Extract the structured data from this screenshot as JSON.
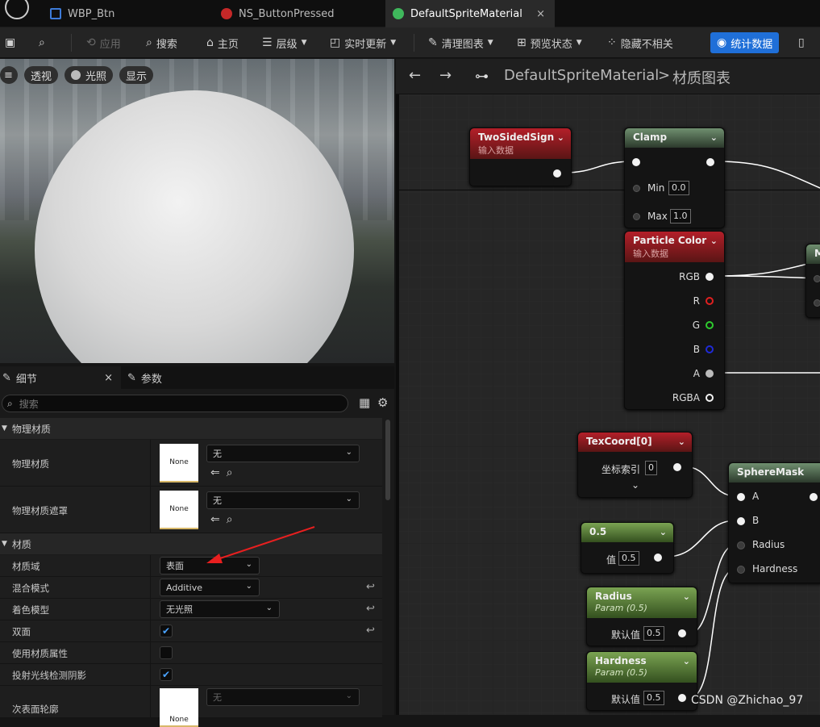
{
  "tabs": [
    {
      "label": "WBP_Btn",
      "icon": "widget-blueprint-icon"
    },
    {
      "label": "NS_ButtonPressed",
      "icon": "niagara-system-icon"
    },
    {
      "label": "DefaultSpriteMaterial",
      "icon": "material-icon",
      "close": "×"
    }
  ],
  "toolbar": {
    "apply": "应用",
    "search": "搜索",
    "home": "主页",
    "hierarchy": "层级",
    "live_update": "实时更新",
    "clean_graph": "清理图表",
    "preview_state": "预览状态",
    "hide_unrelated": "隐藏不相关",
    "stats": "统计数据"
  },
  "viewport": {
    "perspective": "透视",
    "lit": "光照",
    "show": "显示"
  },
  "details": {
    "tab_details": "细节",
    "tab_details_close": "×",
    "tab_params": "参数",
    "search_placeholder": "搜索",
    "cat_physical": "物理材质",
    "phys_mat_label": "物理材质",
    "phys_mat_thumb": "None",
    "phys_mat_value": "无",
    "phys_mask_label": "物理材质遮罩",
    "phys_mask_thumb": "None",
    "phys_mask_value": "无",
    "cat_material": "材质",
    "domain_label": "材质域",
    "domain_value": "表面",
    "blend_label": "混合模式",
    "blend_value": "Additive",
    "shading_label": "着色模型",
    "shading_value": "无光照",
    "two_sided_label": "双面",
    "two_sided_checked": true,
    "use_attr_label": "使用材质属性",
    "use_attr_checked": false,
    "raytrace_shadow_label": "投射光线检测阴影",
    "raytrace_shadow_checked": true,
    "subsurface_label": "次表面轮廓",
    "subsurface_thumb": "None",
    "subsurface_value": "无"
  },
  "graph": {
    "breadcrumb_asset": "DefaultSpriteMaterial",
    "breadcrumb_sep": ">",
    "breadcrumb_graph": "材质图表",
    "nodes": {
      "twosided": {
        "title": "TwoSidedSign",
        "sub": "输入数据"
      },
      "clamp": {
        "title": "Clamp",
        "min_label": "Min",
        "min_value": "0.0",
        "max_label": "Max",
        "max_value": "1.0"
      },
      "particle": {
        "title": "Particle Color",
        "sub": "输入数据",
        "pins": [
          "RGB",
          "R",
          "G",
          "B",
          "A",
          "RGBA"
        ]
      },
      "texcoord": {
        "title": "TexCoord[0]",
        "index_label": "坐标索引",
        "index_value": "0"
      },
      "spheremask": {
        "title": "SphereMask",
        "pins": [
          "A",
          "B",
          "Radius",
          "Hardness"
        ]
      },
      "const": {
        "title": "0.5",
        "value_label": "值",
        "value": "0.5"
      },
      "radius": {
        "title": "Radius",
        "sub": "Param (0.5)",
        "default_label": "默认值",
        "default_value": "0.5"
      },
      "hardness": {
        "title": "Hardness",
        "sub": "Param (0.5)",
        "default_label": "默认值",
        "default_value": "0.5"
      },
      "partial": {
        "title": "M"
      }
    }
  },
  "watermark": "CSDN @Zhichao_97",
  "colors": {
    "accent": "#1f6fd8",
    "red_node": "#b31f29",
    "green_node": "#7aa352"
  }
}
